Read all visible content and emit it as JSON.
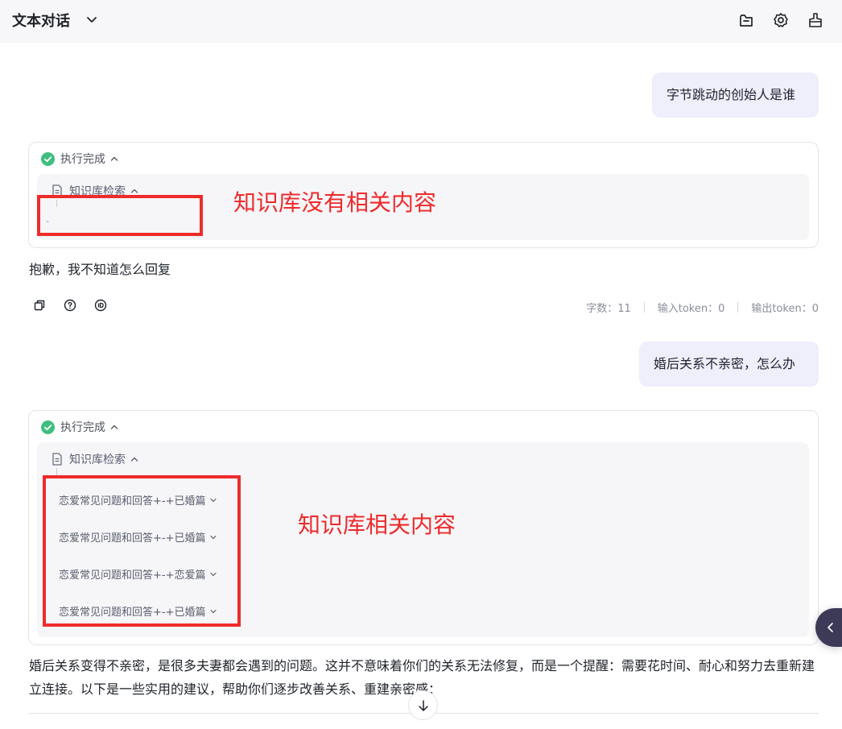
{
  "header": {
    "title": "文本对话",
    "icons": [
      "folder-icon",
      "gear-icon",
      "clear-icon"
    ]
  },
  "conversation": {
    "q1": "字节跳动的创始人是谁",
    "exec1": {
      "status": "执行完成",
      "kb_label": "知识库检索",
      "empty_marker": "-"
    },
    "a1": "抱歉，我不知道怎么回复",
    "stats": {
      "chars": "字数：11",
      "input_tokens": "输入token：0",
      "output_tokens": "输出token：0"
    },
    "q2": "婚后关系不亲密，怎么办",
    "exec2": {
      "status": "执行完成",
      "kb_label": "知识库检索",
      "items": [
        "恋爱常见问题和回答+-+已婚篇",
        "恋爱常见问题和回答+-+已婚篇",
        "恋爱常见问题和回答+-+恋爱篇",
        "恋爱常见问题和回答+-+已婚篇"
      ]
    },
    "a2": "婚后关系变得不亲密，是很多夫妻都会遇到的问题。这并不意味着你们的关系无法修复，而是一个提醒：需要花时间、耐心和努力去重新建立连接。以下是一些实用的建议，帮助你们逐步改善关系、重建亲密感："
  },
  "annotations": {
    "no_content": "知识库没有相关内容",
    "has_content": "知识库相关内容",
    "color": "#ee2b2b"
  },
  "colors": {
    "user_bubble": "#efeefb",
    "success": "#3fbf7f",
    "side_toggle": "#3d3a58"
  }
}
